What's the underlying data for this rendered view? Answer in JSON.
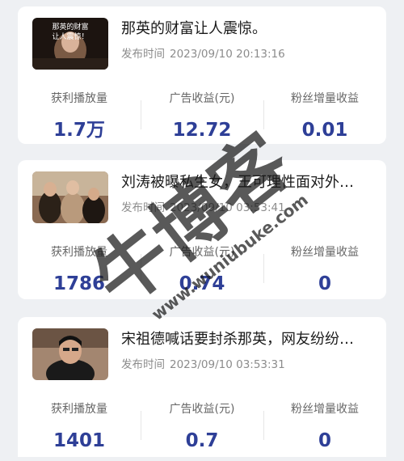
{
  "articles": [
    {
      "title": "那英的财富让人震惊。",
      "time_label": "发布时间",
      "time": "2023/09/10 20:13:16",
      "thumb_caption_top": "那英的财富",
      "thumb_caption_mid": "让人震惊！",
      "stats": [
        {
          "label": "获利播放量",
          "value": "1.7万"
        },
        {
          "label": "广告收益(元)",
          "value": "12.72"
        },
        {
          "label": "粉丝增量收益",
          "value": "0.01"
        }
      ]
    },
    {
      "title": "刘涛被曝私生女，王可理性面对外…",
      "time_label": "发布时间",
      "time": "2023/09/10 03:53:41",
      "stats": [
        {
          "label": "获利播放量",
          "value": "1786"
        },
        {
          "label": "广告收益(元)",
          "value": "0.74"
        },
        {
          "label": "粉丝增量收益",
          "value": "0"
        }
      ]
    },
    {
      "title": "宋祖德喊话要封杀那英，网友纷纷…",
      "time_label": "发布时间",
      "time": "2023/09/10 03:53:31",
      "stats": [
        {
          "label": "获利播放量",
          "value": "1401"
        },
        {
          "label": "广告收益(元)",
          "value": "0.7"
        },
        {
          "label": "粉丝增量收益",
          "value": "0"
        }
      ]
    }
  ],
  "watermark": {
    "brand": "牛博客",
    "url": "www.wuniubuke.com",
    "color": "#1a1a1a"
  },
  "colors": {
    "value": "#2e3f97",
    "background": "#eef0f3"
  }
}
